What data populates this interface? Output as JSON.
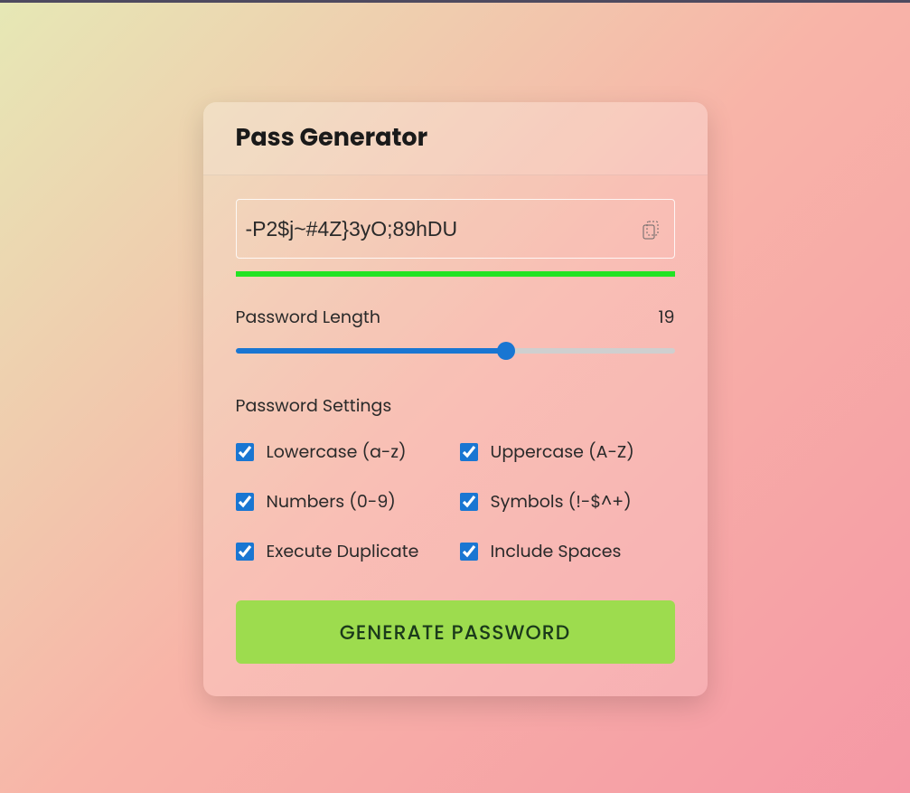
{
  "header": {
    "title": "Pass Generator"
  },
  "password": {
    "value": "-P2$j~#4Z}3yO;89hDU"
  },
  "indicator": {
    "color": "#23e323"
  },
  "length": {
    "label": "Password Length",
    "value": "19",
    "min": 1,
    "max": 30
  },
  "settings": {
    "title": "Password Settings",
    "options": [
      {
        "label": "Lowercase (a-z)",
        "checked": true
      },
      {
        "label": "Uppercase (A-Z)",
        "checked": true
      },
      {
        "label": "Numbers (0-9)",
        "checked": true
      },
      {
        "label": "Symbols (!-$^+)",
        "checked": true
      },
      {
        "label": "Execute Duplicate",
        "checked": true
      },
      {
        "label": "Include Spaces",
        "checked": true
      }
    ]
  },
  "generate": {
    "label": "GENERATE PASSWORD"
  }
}
